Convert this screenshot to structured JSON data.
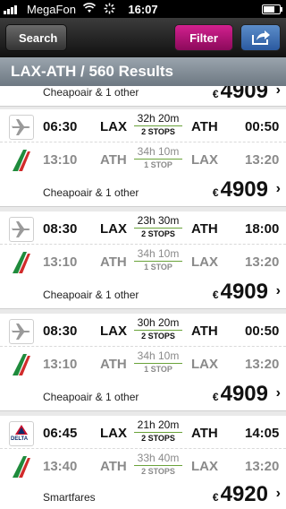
{
  "status": {
    "carrier": "MegaFon",
    "time": "16:07"
  },
  "nav": {
    "back": "Search",
    "filter": "Filter"
  },
  "header": {
    "title": "LAX-ATH / 560 Results"
  },
  "partial": {
    "agent": "Cheapoair & 1 other",
    "price": "4909",
    "currency": "€"
  },
  "results": [
    {
      "outbound": {
        "dep": "06:30",
        "from": "LAX",
        "duration": "32h 20m",
        "stops": "2 STOPS",
        "to": "ATH",
        "arr": "00:50",
        "airline": "plane-icon"
      },
      "return": {
        "dep": "13:10",
        "from": "ATH",
        "duration": "34h 10m",
        "stops": "1 STOP",
        "to": "LAX",
        "arr": "13:20",
        "airline": "alitalia-logo"
      },
      "agent": "Cheapoair & 1 other",
      "price": "4909",
      "currency": "€"
    },
    {
      "outbound": {
        "dep": "08:30",
        "from": "LAX",
        "duration": "23h 30m",
        "stops": "2 STOPS",
        "to": "ATH",
        "arr": "18:00",
        "airline": "plane-icon"
      },
      "return": {
        "dep": "13:10",
        "from": "ATH",
        "duration": "34h 10m",
        "stops": "1 STOP",
        "to": "LAX",
        "arr": "13:20",
        "airline": "alitalia-logo"
      },
      "agent": "Cheapoair & 1 other",
      "price": "4909",
      "currency": "€"
    },
    {
      "outbound": {
        "dep": "08:30",
        "from": "LAX",
        "duration": "30h 20m",
        "stops": "2 STOPS",
        "to": "ATH",
        "arr": "00:50",
        "airline": "plane-icon"
      },
      "return": {
        "dep": "13:10",
        "from": "ATH",
        "duration": "34h 10m",
        "stops": "1 STOP",
        "to": "LAX",
        "arr": "13:20",
        "airline": "alitalia-logo"
      },
      "agent": "Cheapoair & 1 other",
      "price": "4909",
      "currency": "€"
    },
    {
      "outbound": {
        "dep": "06:45",
        "from": "LAX",
        "duration": "21h 20m",
        "stops": "2 STOPS",
        "to": "ATH",
        "arr": "14:05",
        "airline": "delta-logo"
      },
      "return": {
        "dep": "13:40",
        "from": "ATH",
        "duration": "33h 40m",
        "stops": "2 STOPS",
        "to": "LAX",
        "arr": "13:20",
        "airline": "alitalia-logo"
      },
      "agent": "Smartfares",
      "price": "4920",
      "currency": "€"
    }
  ],
  "delta_label": "DELTA",
  "colors": {
    "accent": "#c4147e",
    "brand": "#2b5aa0",
    "duration_line": "#6aa33a"
  }
}
